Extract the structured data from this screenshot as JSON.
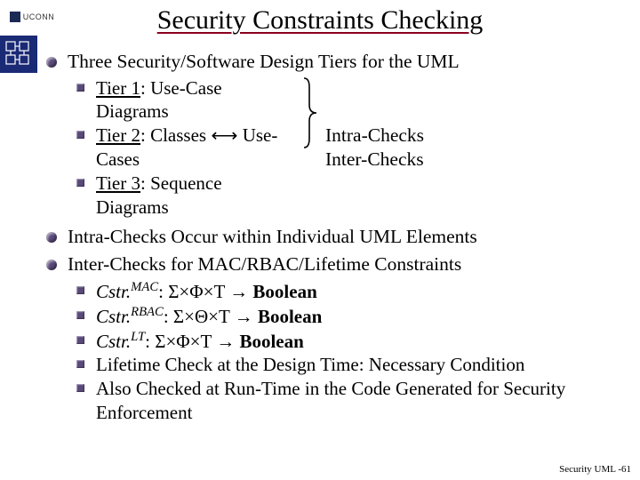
{
  "header": {
    "uconn_label": "UCONN",
    "title": "Security Constraints Checking"
  },
  "bullets": {
    "b1": {
      "text": "Three Security/Software Design Tiers for the UML",
      "tier1_label": "Tier 1",
      "tier1_rest": ": Use-Case Diagrams",
      "tier2_label": "Tier 2",
      "tier2_rest": ": Classes ⟷ Use-Cases",
      "tier3_label": "Tier 3",
      "tier3_rest": ": Sequence Diagrams",
      "bracket_line1": "Intra-Checks",
      "bracket_line2": "Inter-Checks"
    },
    "b2": "Intra-Checks Occur within Individual UML Elements",
    "b3": {
      "text": "Inter-Checks for MAC/RBAC/Lifetime Constraints",
      "c1_name": "Cstr.",
      "c1_sup": "MAC",
      "c1_rest": ": Σ×Φ×T → ",
      "c1_bool": "Boolean",
      "c2_name": "Cstr.",
      "c2_sup": "RBAC",
      "c2_rest": ": Σ×Θ×T → ",
      "c2_bool": "Boolean",
      "c3_name": "Cstr.",
      "c3_sup": "LT",
      "c3_rest": ": Σ×Φ×T → ",
      "c3_bool": "Boolean",
      "c4": "Lifetime Check at the Design Time: Necessary Condition",
      "c5": "Also Checked at Run-Time in the Code Generated for Security Enforcement"
    }
  },
  "footer": "Security UML -61"
}
